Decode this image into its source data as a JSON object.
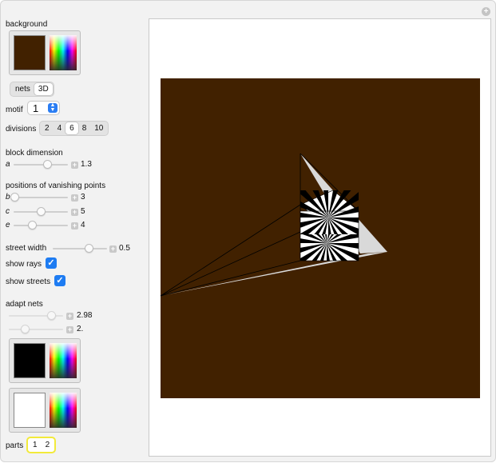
{
  "background_label": "background",
  "background_color": "#412100",
  "mode_options": [
    "nets",
    "3D"
  ],
  "mode_selected": "3D",
  "motif_label": "motif",
  "motif_value": "1",
  "divisions_label": "divisions",
  "divisions_options": [
    "2",
    "4",
    "6",
    "8",
    "10"
  ],
  "divisions_selected": "6",
  "block_dimension_label": "block dimension",
  "a_label": "a",
  "a_value": "1.3",
  "a_fraction": 0.62,
  "vanishing_label": "positions of vanishing points",
  "b_label": "b",
  "b_value": "3",
  "b_fraction": 0.02,
  "c_label": "c",
  "c_value": "5",
  "c_fraction": 0.5,
  "e_label": "e",
  "e_value": "4",
  "e_fraction": 0.34,
  "street_width_label": "street width",
  "street_width_value": "0.5",
  "street_width_fraction": 0.66,
  "show_rays_label": "show rays",
  "show_rays_checked": true,
  "show_streets_label": "show streets",
  "show_streets_checked": true,
  "adapt_nets_label": "adapt nets",
  "adapt1_value": "2.98",
  "adapt1_fraction": 0.78,
  "adapt2_value": "2.",
  "adapt2_fraction": 0.3,
  "net_color1": "#000000",
  "net_color2": "#ffffff",
  "parts_label": "parts",
  "parts_options": [
    "1",
    "2"
  ],
  "street_color": "#d9d9d9",
  "icons": [
    "plus-circle-icon",
    "stepper-icon",
    "plus-square-icon",
    "checkmark-icon"
  ]
}
